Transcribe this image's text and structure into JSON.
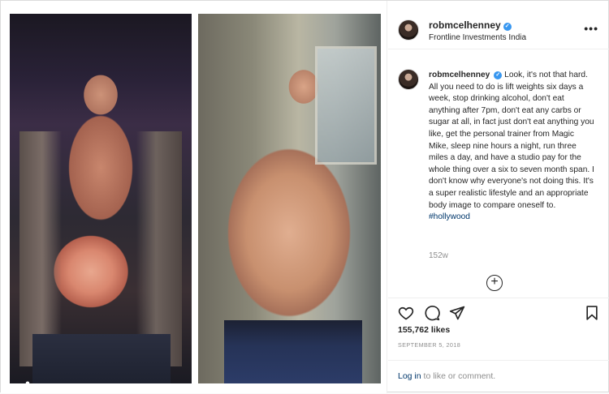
{
  "post": {
    "username": "robmcelhenney",
    "location": "Frontline Investments India",
    "caption": "Look, it's not that hard. All you need to do is lift weights six days a week, stop drinking alcohol, don't eat anything after 7pm, don't eat any carbs or sugar at all, in fact just don't eat anything you like, get the personal trainer from Magic Mike, sleep nine hours a night, run three miles a day, and have a studio pay for the whole thing over a six to seven month span. I don't know why everyone's not doing this. It's a super realistic lifestyle and an appropriate body image to compare oneself to.",
    "hashtag": "#hollywood",
    "time_ago": "152w",
    "likes": "155,762 likes",
    "date": "SEPTEMBER 5, 2018"
  },
  "login": {
    "link": "Log in",
    "suffix": " to like or comment."
  },
  "icons": {
    "more": "more-options-icon",
    "verified": "verified-badge-icon",
    "like": "heart-icon",
    "comment": "comment-icon",
    "share": "paper-plane-icon",
    "save": "bookmark-icon",
    "load_more": "plus-circle-icon",
    "tag": "user-tag-icon"
  },
  "colors": {
    "verified": "#3897f0",
    "link": "#00376b",
    "muted": "#8e8e8e",
    "text": "#262626"
  }
}
